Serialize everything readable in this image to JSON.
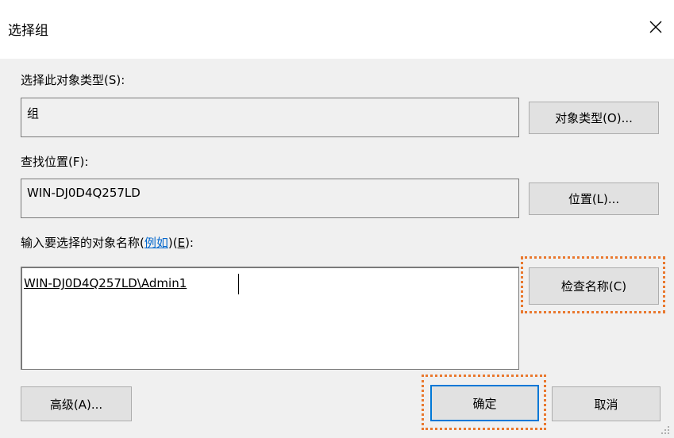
{
  "dialog": {
    "title": "选择组",
    "close_glyph": "✕"
  },
  "object_type": {
    "label": "选择此对象类型(S):",
    "value": "组",
    "button_label": "对象类型(O)..."
  },
  "location": {
    "label": "查找位置(F):",
    "value": "WIN-DJ0D4Q257LD",
    "button_label": "位置(L)..."
  },
  "object_names": {
    "label_prefix": "输入要选择的对象名称(",
    "example_link": "例如",
    "label_mid": ")(",
    "label_key": "E",
    "label_suffix": "):",
    "value": "WIN-DJ0D4Q257LD\\Admin1",
    "check_names_button": "检查名称(C)"
  },
  "footer": {
    "advanced_button": "高级(A)...",
    "ok_button": "确定",
    "cancel_button": "取消"
  },
  "colors": {
    "highlight": "#e9782e",
    "default_border": "#0078d7",
    "link": "#0066cc"
  }
}
